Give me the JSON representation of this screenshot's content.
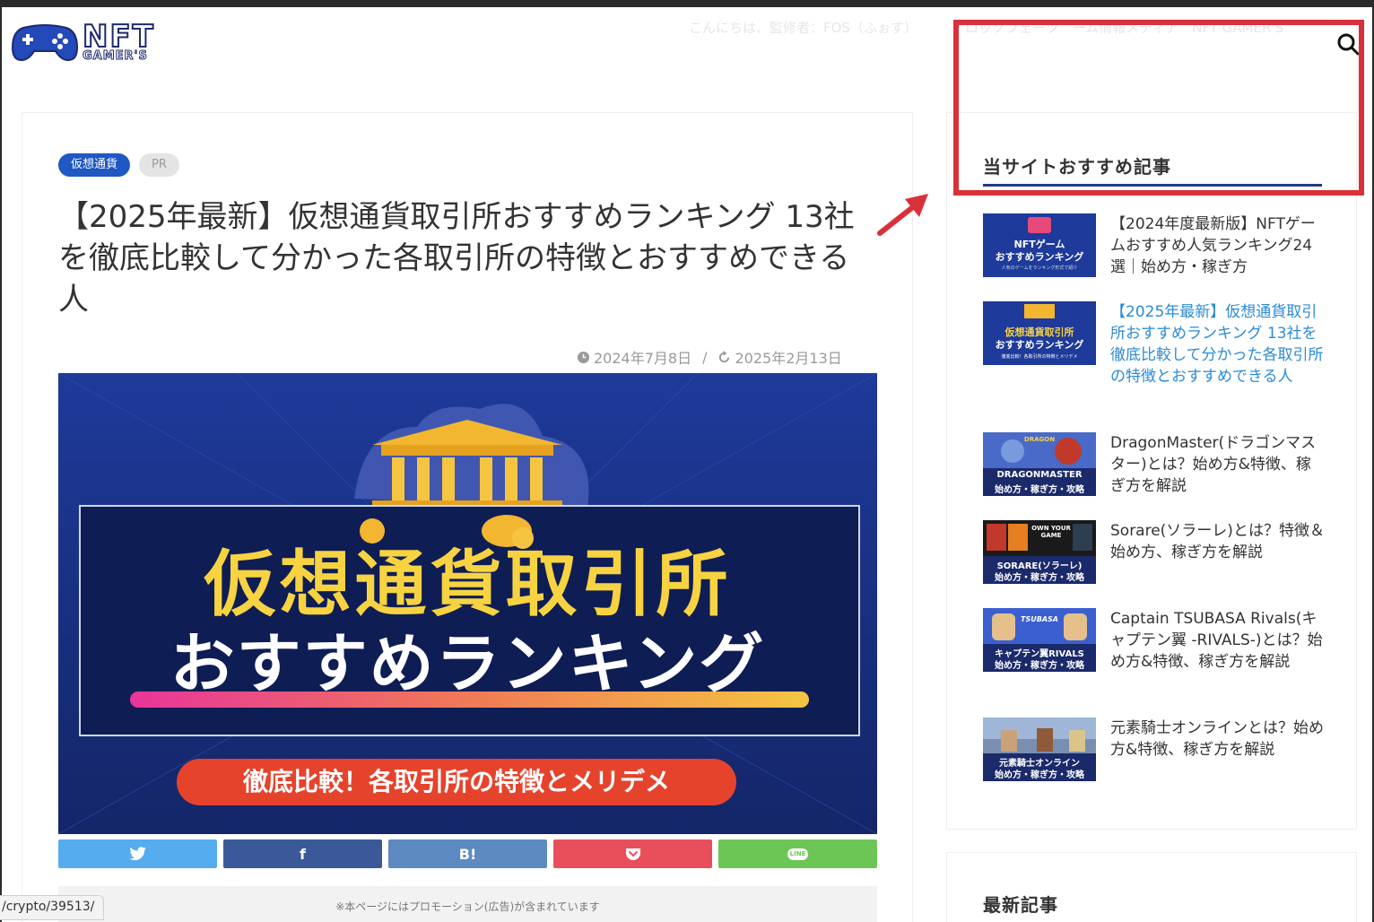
{
  "header": {
    "logo_line1": "NFT",
    "logo_line2": "GAMER'S",
    "greeting": "こんにちは、監修者：FOS（ふぉす）",
    "nav_text": "ロッソフェーツ　ーム情報メディア　NFT GAMER'S"
  },
  "article": {
    "category_tag": "仮想通貨",
    "pr_tag": "PR",
    "title": "【2025年最新】仮想通貨取引所おすすめランキング 13社を徹底比較して分かった各取引所の特徴とおすすめできる人",
    "published": "2024年7月8日",
    "separator": "/",
    "updated": "2025年2月13日",
    "hero_main": "仮想通貨取引所",
    "hero_sub": "おすすめランキング",
    "hero_pill": "徹底比較！各取引所の特徴とメリデメ",
    "promo_notice": "※本ページにはプロモーション(広告)が含まれています"
  },
  "share": {
    "twitter": "twitter-icon",
    "facebook": "f",
    "hatena": "B!",
    "pocket": "pocket-icon",
    "line": "LINE"
  },
  "sidebar": {
    "heading": "当サイトおすすめ記事",
    "items": [
      {
        "title": "【2024年度最新版】NFTゲームおすすめ人気ランキング24選｜始め方・稼ぎ方",
        "thumb_line1": "NFTゲーム",
        "thumb_line2": "おすすめランキング",
        "thumb_line3": "人気のゲームをランキング形式で紹介"
      },
      {
        "title": "【2025年最新】仮想通貨取引所おすすめランキング 13社を徹底比較して分かった各取引所の特徴とおすすめできる人",
        "thumb_line1": "仮想通貨取引所",
        "thumb_line2": "おすすめランキング",
        "thumb_line3": "徹底比較！各取引所の特徴とメリデメ"
      },
      {
        "title": "DragonMaster(ドラゴンマスター)とは？始め方&特徴、稼ぎ方を解説",
        "thumb_line1": "DRAGONMASTER",
        "thumb_line2": "始め方・稼ぎ方・攻略",
        "thumb_line3": "DRAGON"
      },
      {
        "title": "Sorare(ソラーレ)とは？特徴＆始め方、稼ぎ方を解説",
        "thumb_line1": "SORARE(ソラーレ)",
        "thumb_line2": "始め方・稼ぎ方・攻略",
        "thumb_line3": "OWN YOUR GAME"
      },
      {
        "title": "Captain TSUBASA Rivals(キャプテン翼 -RIVALS-)とは？始め方&特徴、稼ぎ方を解説",
        "thumb_line1": "キャプテン翼RIVALS",
        "thumb_line2": "始め方・稼ぎ方・攻略",
        "thumb_line3": "TSUBASA"
      },
      {
        "title": "元素騎士オンラインとは？始め方&特徴、稼ぎ方を解説",
        "thumb_line1": "元素騎士オンライン",
        "thumb_line2": "始め方・稼ぎ方・攻略",
        "thumb_line3": ""
      }
    ],
    "heading2": "最新記事"
  },
  "status_url": "/crypto/39513/",
  "colors": {
    "accent_blue": "#1f57c3",
    "highlight_red": "#d9303a",
    "active_link": "#2b8bd6"
  }
}
